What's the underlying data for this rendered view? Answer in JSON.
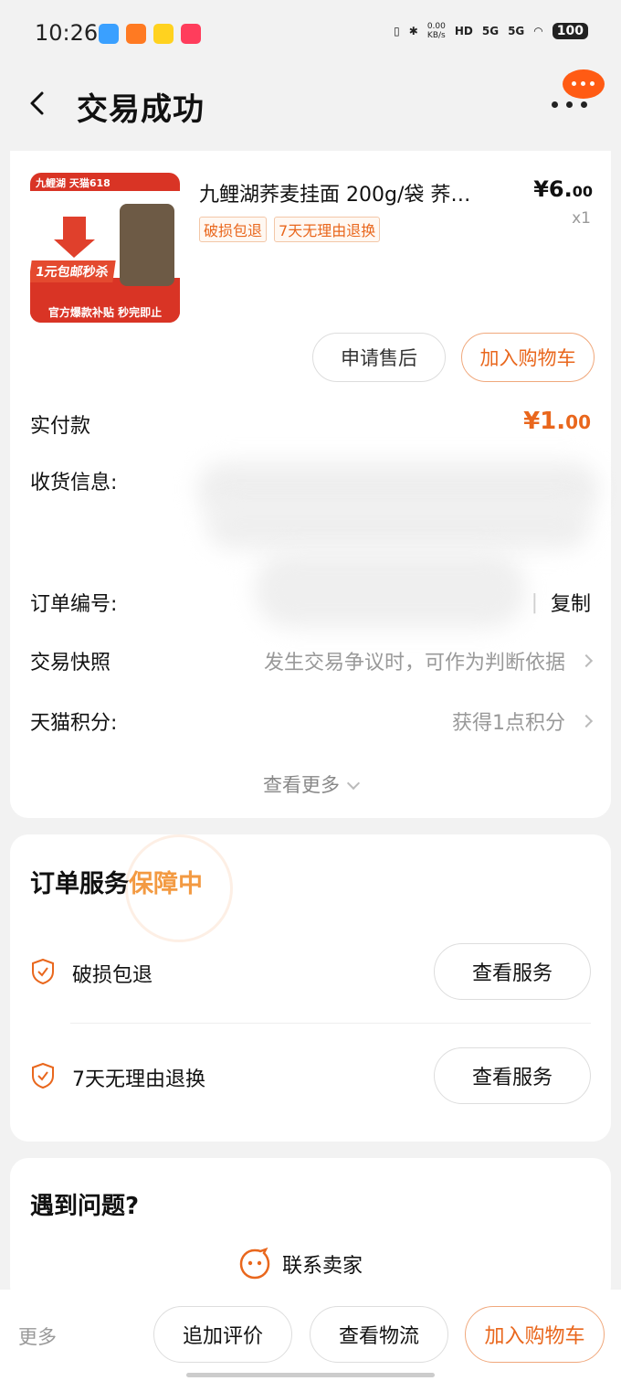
{
  "status_bar": {
    "time": "10:26",
    "network_speed": "0.00",
    "network_unit": "KB/s",
    "hd": "HD",
    "sim1": "5G",
    "sim2": "5G",
    "battery": "100"
  },
  "header": {
    "title": "交易成功"
  },
  "product": {
    "thumb_top": "九鲤湖 天猫618",
    "thumb_promo": "1元包邮秒杀",
    "thumb_bottom": "官方爆款补贴 秒完即止",
    "name": "九鲤湖荞麦挂面 200g/袋 荞…",
    "tags": [
      "破损包退",
      "7天无理由退换"
    ],
    "price_main": "¥6.",
    "price_decimal": "00",
    "quantity": "x1",
    "after_sale_button": "申请售后",
    "add_cart_button": "加入购物车"
  },
  "order": {
    "paid_label": "实付款",
    "paid_main": "¥1.",
    "paid_decimal": "00",
    "shipping_label": "收货信息:",
    "order_no_label": "订单编号:",
    "copy_label": "复制",
    "snapshot_label": "交易快照",
    "snapshot_value": "发生交易争议时，可作为判断依据",
    "points_label": "天猫积分:",
    "points_value": "获得1点积分",
    "see_more": "查看更多"
  },
  "service": {
    "title_prefix": "订单服务",
    "title_highlight": "保障中",
    "items": [
      {
        "label": "破损包退",
        "button": "查看服务"
      },
      {
        "label": "7天无理由退换",
        "button": "查看服务"
      }
    ]
  },
  "help": {
    "title": "遇到问题?",
    "contact": "联系卖家"
  },
  "bottom_bar": {
    "more": "更多",
    "review": "追加评价",
    "logistics": "查看物流",
    "add_cart": "加入购物车"
  },
  "colors": {
    "accent": "#e9671d",
    "highlight": "#f39a42",
    "background": "#f2f2f2"
  }
}
